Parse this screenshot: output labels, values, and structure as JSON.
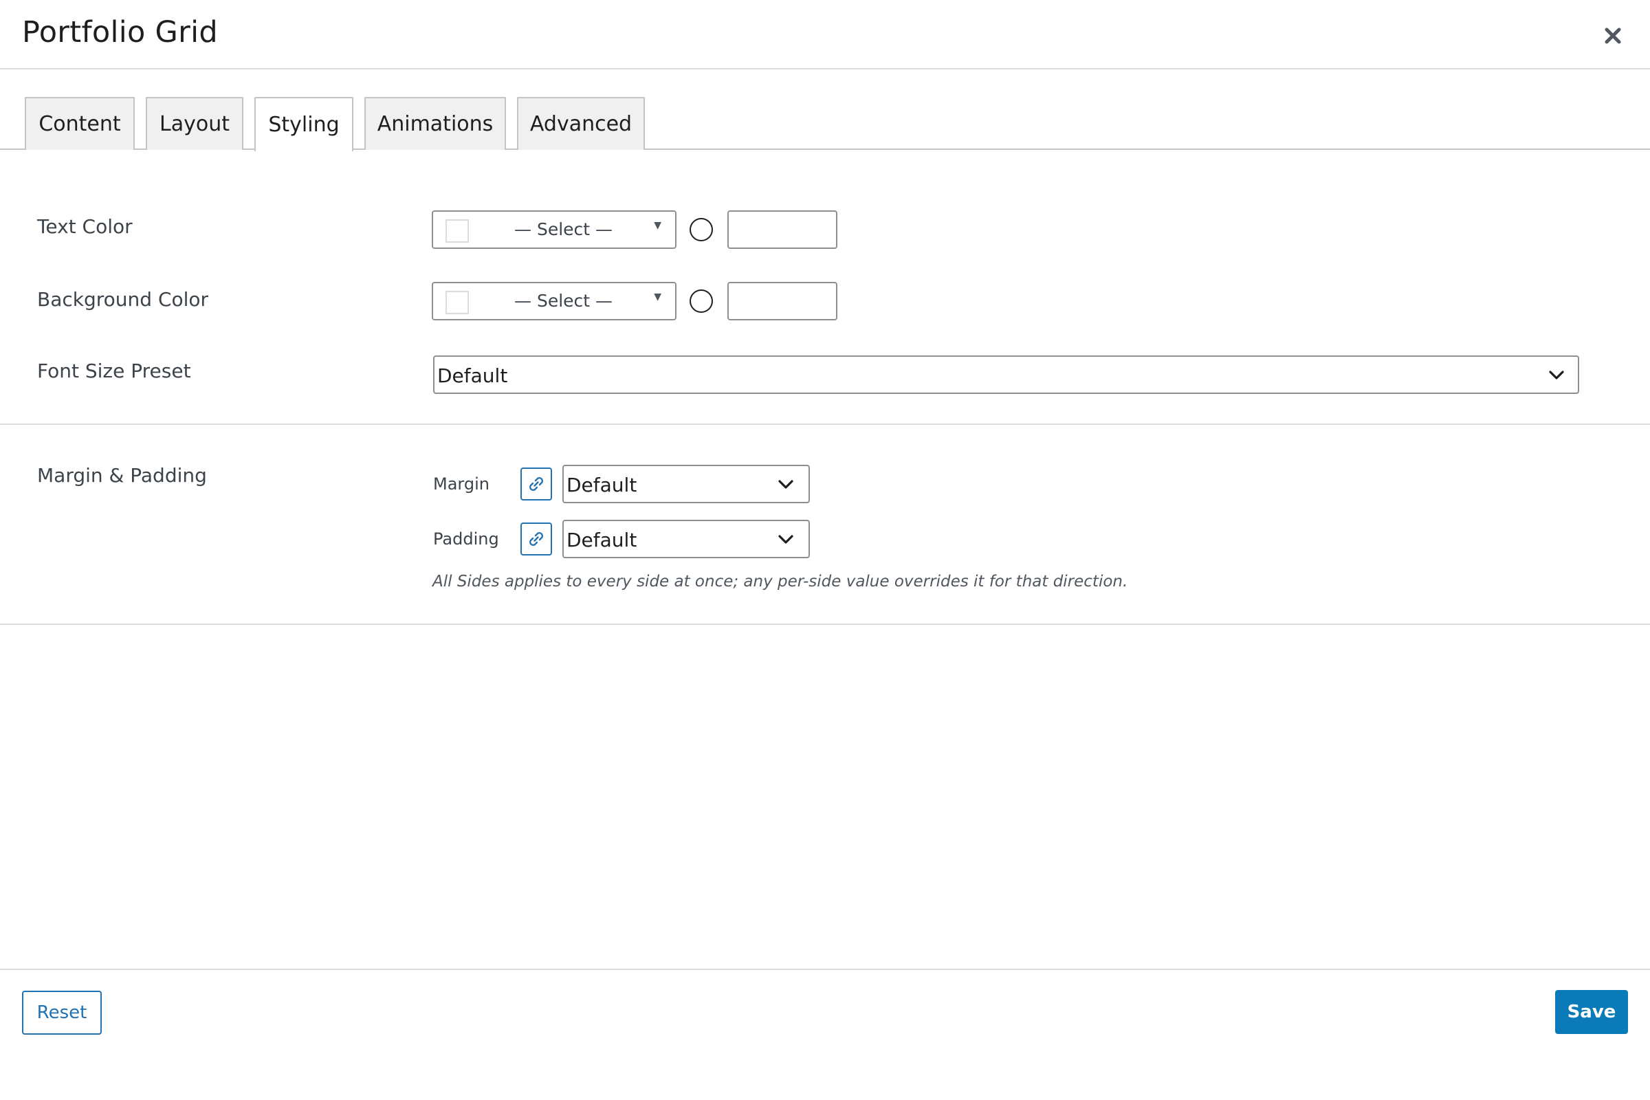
{
  "dialog": {
    "title": "Portfolio Grid",
    "close_icon": "close-icon"
  },
  "tabs": [
    {
      "label": "Content",
      "active": false
    },
    {
      "label": "Layout",
      "active": false
    },
    {
      "label": "Styling",
      "active": true
    },
    {
      "label": "Animations",
      "active": false
    },
    {
      "label": "Advanced",
      "active": false
    }
  ],
  "styling": {
    "text_color": {
      "label": "Text Color",
      "select_text": "— Select —",
      "hex_value": ""
    },
    "background_color": {
      "label": "Background Color",
      "select_text": "— Select —",
      "hex_value": ""
    },
    "font_size_preset": {
      "label": "Font Size Preset",
      "value": "Default"
    }
  },
  "spacing": {
    "label": "Margin & Padding",
    "margin": {
      "label": "Margin",
      "value": "Default",
      "icon": "link-icon"
    },
    "padding": {
      "label": "Padding",
      "value": "Default",
      "icon": "link-icon"
    },
    "help": "All Sides applies to every side at once; any per-side value overrides it for that direction."
  },
  "footer": {
    "reset_label": "Reset",
    "save_label": "Save"
  },
  "colors": {
    "accent": "#2271b1",
    "save_button": "#0a7ab8",
    "border": "#8c8f94",
    "divider": "#dcdcde"
  }
}
